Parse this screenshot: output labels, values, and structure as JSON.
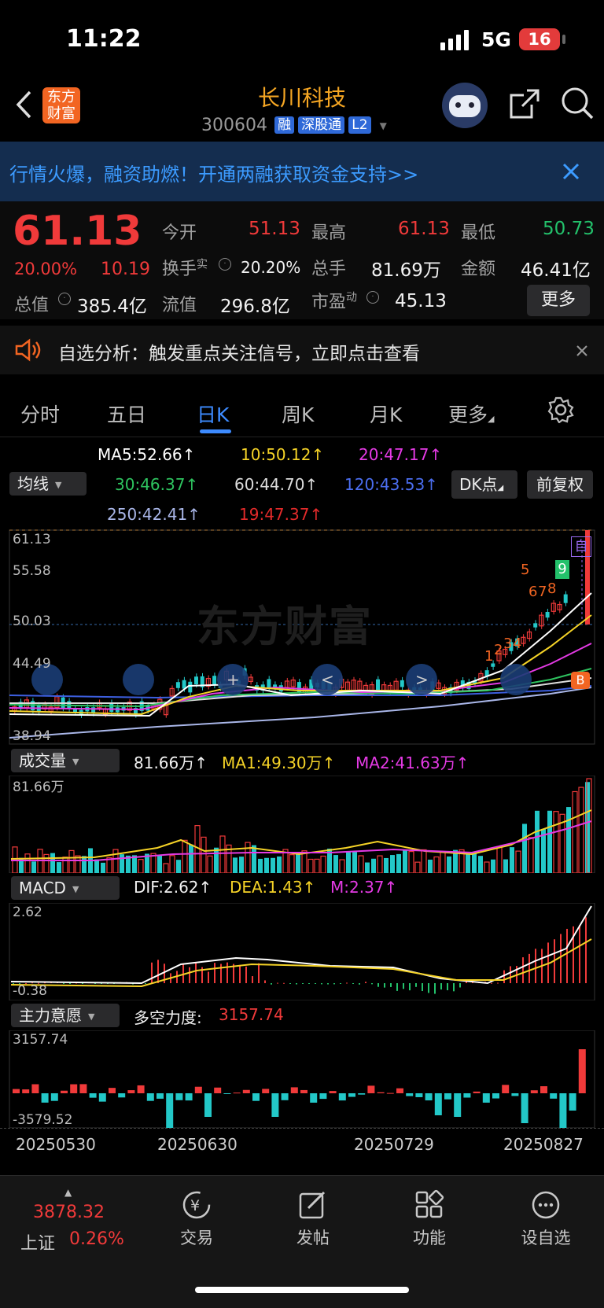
{
  "status_bar": {
    "time": "11:22",
    "network": "5G",
    "battery": "16"
  },
  "header": {
    "logo_text": "东方财富",
    "stock_name": "长川科技",
    "stock_code": "300604",
    "badges": [
      "融",
      "深股通",
      "L2"
    ]
  },
  "banner": {
    "text": "行情火爆，融资助燃！开通两融获取资金支持>>"
  },
  "quote": {
    "price": "61.13",
    "change_pct": "20.00%",
    "change": "10.19",
    "open_label": "今开",
    "open": "51.13",
    "high_label": "最高",
    "high": "61.13",
    "low_label": "最低",
    "low": "50.73",
    "turnover_label": "换手",
    "turnover_sup": "实",
    "turnover": "20.20%",
    "volume_label": "总手",
    "volume": "81.69万",
    "amount_label": "金额",
    "amount": "46.41亿",
    "mktcap_label": "总值",
    "mktcap": "385.4亿",
    "float_label": "流值",
    "float": "296.8亿",
    "pe_label": "市盈",
    "pe_sup": "动",
    "pe": "45.13",
    "more_button": "更多"
  },
  "notice": {
    "text": "自选分析：触发重点关注信号，立即点击查看"
  },
  "tabs": [
    {
      "label": "分时",
      "active": false
    },
    {
      "label": "五日",
      "active": false
    },
    {
      "label": "日K",
      "active": true
    },
    {
      "label": "周K",
      "active": false
    },
    {
      "label": "月K",
      "active": false
    },
    {
      "label": "更多",
      "active": false
    }
  ],
  "ma_panel": {
    "selector": "均线",
    "ma5": "MA5:52.66↑",
    "ma10": "10:50.12↑",
    "ma20": "20:47.17↑",
    "ma30": "30:46.37↑",
    "ma60": "60:44.70↑",
    "ma120": "120:43.53↑",
    "ma250": "250:42.41↑",
    "ma19": "19:47.37↑",
    "dk_button": "DK点",
    "adjust_button": "前复权",
    "colors": {
      "ma5": "#ffffff",
      "ma10": "#f5d327",
      "ma20": "#e43ae4",
      "ma30": "#2ec35f",
      "ma60": "#dddddd",
      "ma120": "#3d5fe0",
      "ma250": "#a9b6e8",
      "ma19": "#e22a2a"
    }
  },
  "kline": {
    "y_labels": [
      "61.13",
      "55.58",
      "50.03",
      "44.49",
      "38.94"
    ],
    "watermark": "东方财富",
    "marker_self": "自",
    "marker_b": "B",
    "td_numbers": [
      "1",
      "2",
      "3",
      "4",
      "5",
      "6",
      "7",
      "8",
      "9"
    ]
  },
  "volume_panel": {
    "selector": "成交量",
    "value": "81.66万↑",
    "ma1": "MA1:49.30万↑",
    "ma2": "MA2:41.63万↑",
    "top_label": "81.66万"
  },
  "macd_panel": {
    "selector": "MACD",
    "dif": "DIF:2.62↑",
    "dea": "DEA:1.43↑",
    "m": "M:2.37↑",
    "top_label": "2.62",
    "bottom_label": "-0.38"
  },
  "main_panel": {
    "selector": "主力意愿",
    "label": "多空力度:",
    "value": "3157.74",
    "top_label": "3157.74",
    "bottom_label": "-3579.52"
  },
  "x_dates": [
    "20250530",
    "20250630",
    "20250729",
    "20250827"
  ],
  "bottom_nav": {
    "index_value": "3878.32",
    "index_name": "上证",
    "index_change": "0.26%",
    "items": [
      "交易",
      "发帖",
      "功能",
      "设自选"
    ]
  }
}
